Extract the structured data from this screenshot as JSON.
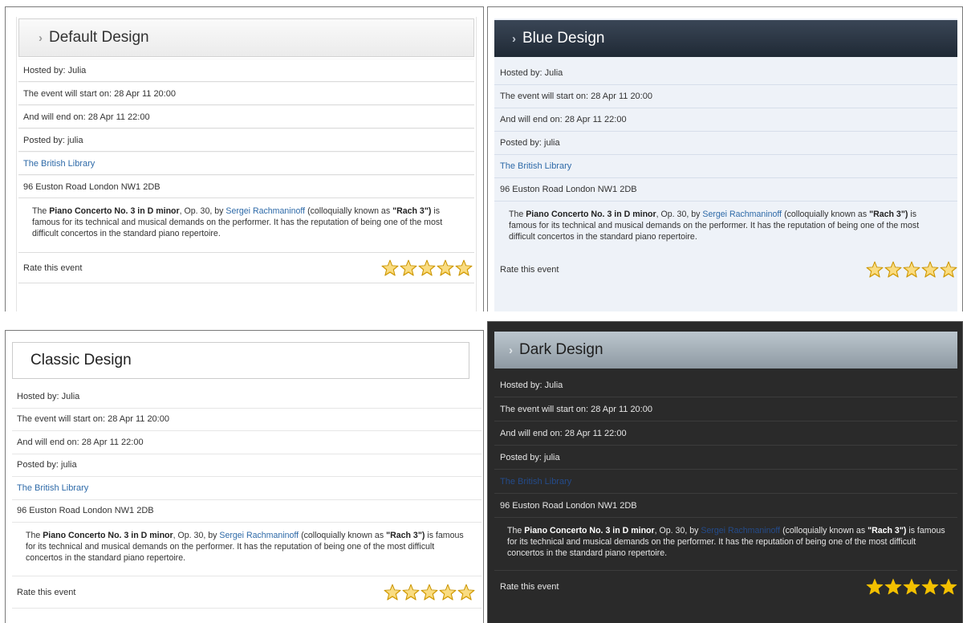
{
  "event": {
    "hosted_by": "Hosted by: Julia",
    "start": "The event will start on: 28 Apr 11 20:00",
    "end": "And will end on: 28 Apr 11 22:00",
    "posted_by": "Posted by: julia",
    "venue": "The British Library",
    "address": "96 Euston Road London NW1 2DB",
    "description": {
      "prefix": "The ",
      "piece": "Piano Concerto No. 3 in D minor",
      "mid": ", Op. 30, by ",
      "composer": "Sergei Rachmaninoff",
      "after_composer": " (colloquially known as ",
      "nickname": "\"Rach 3\")",
      "suffix": " is famous for its technical and musical demands on the performer. It has the reputation of being one of the most difficult concertos in the standard piano repertoire."
    },
    "rate_label": "Rate this event",
    "rating": 5,
    "rating_max": 5
  },
  "designs": [
    {
      "id": "default",
      "title": "Default Design",
      "chevron": "›"
    },
    {
      "id": "blue",
      "title": "Blue Design",
      "chevron": "›"
    },
    {
      "id": "classic",
      "title": "Classic Design"
    },
    {
      "id": "dark",
      "title": "Dark Design",
      "chevron": "›"
    }
  ],
  "colors": {
    "link": "#2e6aa8",
    "dark_link": "#244b8a",
    "star_fill": "#f5c644",
    "star_stroke": "#c99400",
    "dark_star_fill": "#f3c000"
  },
  "icons": {
    "header_marker": "chevron-right-icon",
    "rating": "star-icon"
  }
}
